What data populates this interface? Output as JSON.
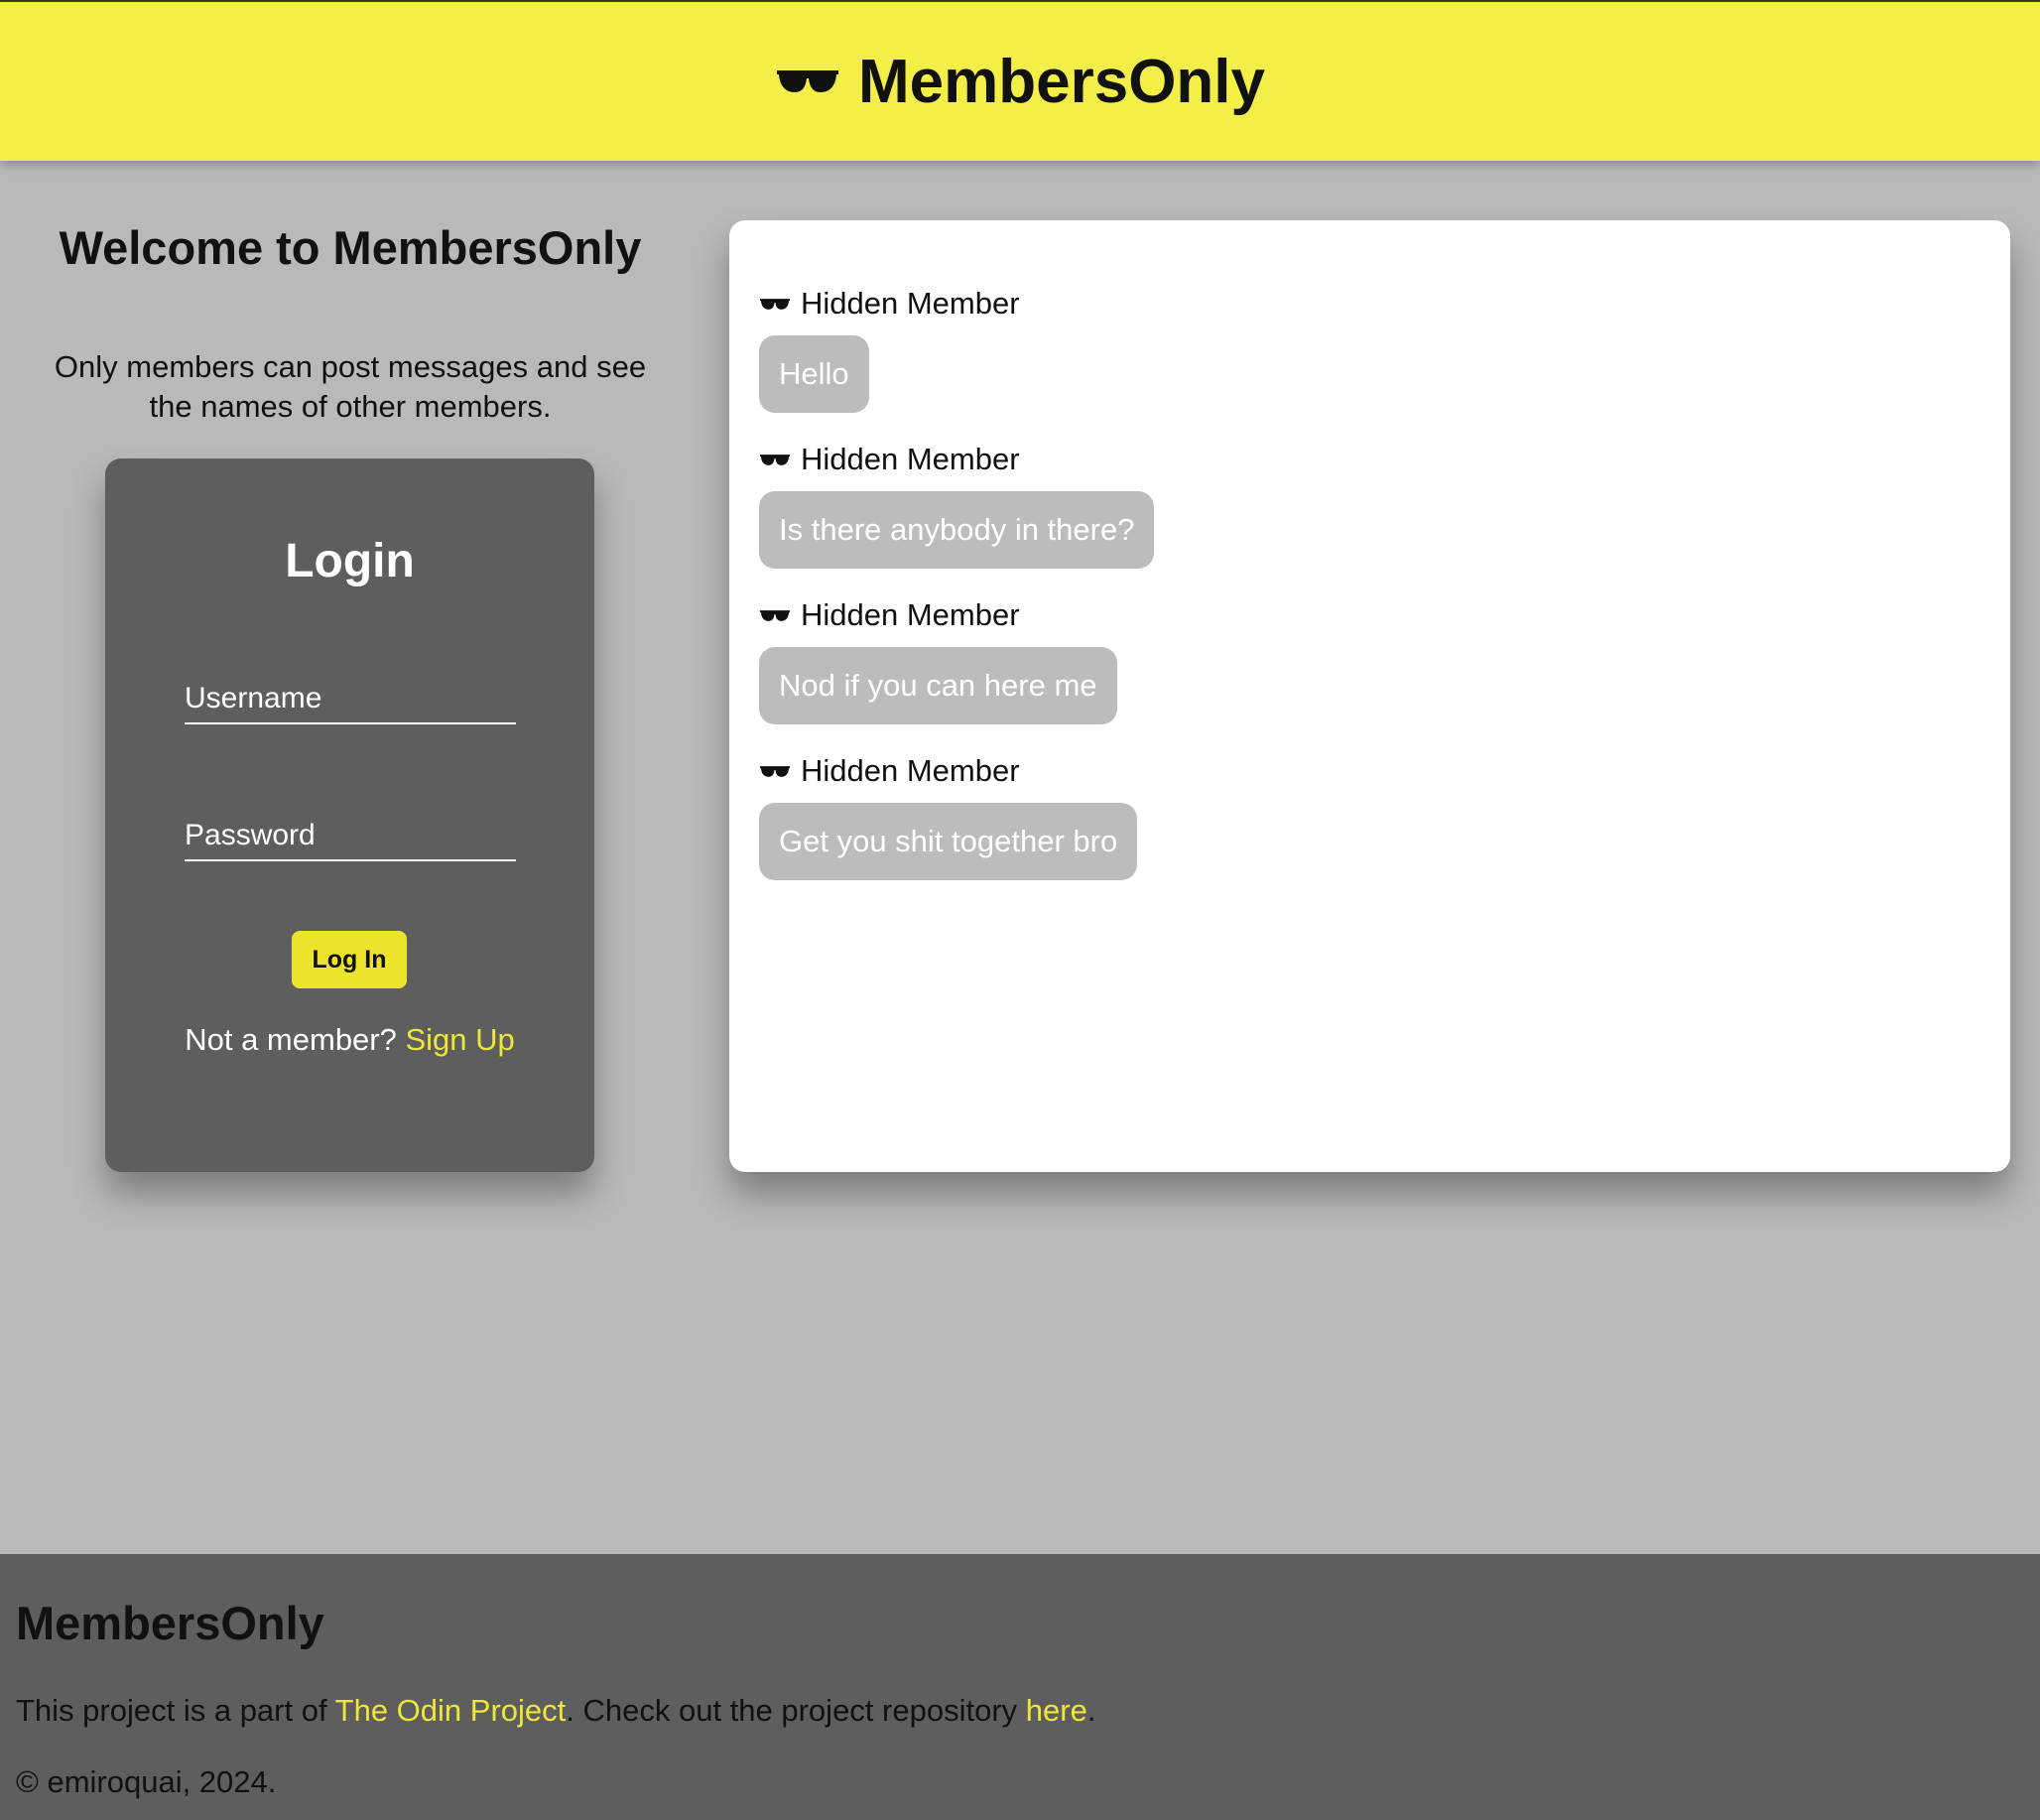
{
  "header": {
    "icon": "sunglasses-icon",
    "title": "MembersOnly"
  },
  "welcome": {
    "title": "Welcome to MembersOnly",
    "text": "Only members can post messages and see the names of other members."
  },
  "login": {
    "title": "Login",
    "username_placeholder": "Username",
    "password_placeholder": "Password",
    "button_label": "Log In",
    "not_member_text": "Not a member?",
    "signup_label": "Sign Up"
  },
  "messages": [
    {
      "author": "Hidden Member",
      "author_icon": "sunglasses-icon",
      "text": "Hello"
    },
    {
      "author": "Hidden Member",
      "author_icon": "sunglasses-icon",
      "text": "Is there anybody in there?"
    },
    {
      "author": "Hidden Member",
      "author_icon": "sunglasses-icon",
      "text": "Nod if you can here me"
    },
    {
      "author": "Hidden Member",
      "author_icon": "sunglasses-icon",
      "text": "Get you shit together bro"
    }
  ],
  "footer": {
    "title": "MembersOnly",
    "text_prefix": "This project is a part of",
    "odin_link": "The Odin Project",
    "text_middle": ". Check out the project repository",
    "repo_link": "here",
    "text_suffix": ".",
    "copyright": "© emiroquai, 2024."
  },
  "colors": {
    "header_bg": "#f3ee48",
    "page_bg": "#b9b9b9",
    "card_bg": "#5e5e5e",
    "accent": "#efe63a",
    "bubble_bg": "#bcbcbc"
  }
}
